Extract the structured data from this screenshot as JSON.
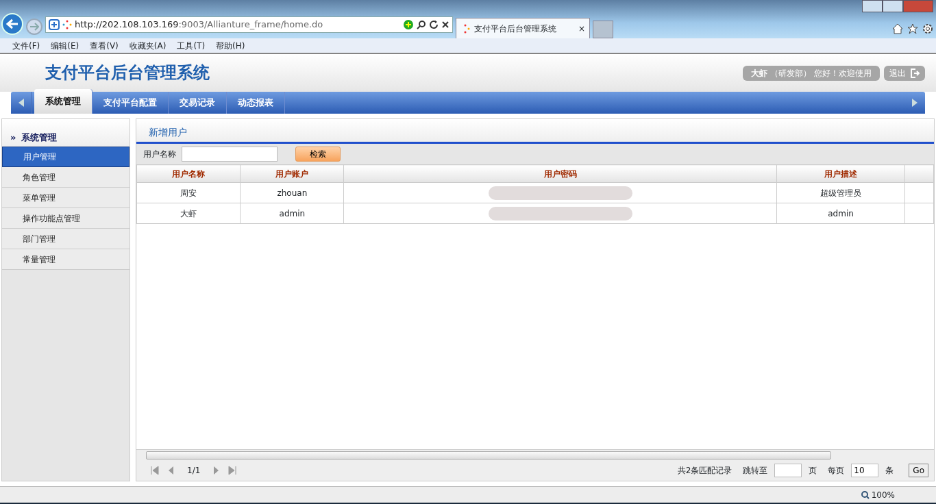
{
  "browser": {
    "url_host": "http://202.108.103.169",
    "url_rest": ":9003/Allianture_frame/home.do",
    "tab_title": "支付平台后台管理系统",
    "tab_close": "×",
    "menu": [
      "文件(F)",
      "编辑(E)",
      "查看(V)",
      "收藏夹(A)",
      "工具(T)",
      "帮助(H)"
    ]
  },
  "app": {
    "title": "支付平台后台管理系统",
    "user": {
      "name": "大虾",
      "dept": "（研发部）",
      "greeting": "您好！欢迎使用"
    },
    "logout": "退出",
    "tabs": [
      {
        "label": "系统管理",
        "selected": true
      },
      {
        "label": "支付平台配置",
        "selected": false
      },
      {
        "label": "交易记录",
        "selected": false
      },
      {
        "label": "动态报表",
        "selected": false
      }
    ]
  },
  "sidebar": {
    "heading": "系统管理",
    "marker": "»",
    "items": [
      {
        "label": "用户管理",
        "selected": true
      },
      {
        "label": "角色管理",
        "selected": false
      },
      {
        "label": "菜单管理",
        "selected": false
      },
      {
        "label": "操作功能点管理",
        "selected": false
      },
      {
        "label": "部门管理",
        "selected": false
      },
      {
        "label": "常量管理",
        "selected": false
      }
    ]
  },
  "panel": {
    "tab": "新增用户",
    "search_label": "用户名称",
    "search_button": "检索",
    "table": {
      "columns": [
        "用户名称",
        "用户账户",
        "用户密码",
        "用户描述"
      ],
      "rows": [
        {
          "cells": [
            "周安",
            "zhouan",
            "",
            "超级管理员"
          ],
          "redacted": true
        },
        {
          "cells": [
            "大虾",
            "admin",
            "",
            "admin"
          ],
          "redacted": true
        }
      ]
    },
    "pager": {
      "page": "1/1",
      "total": "共2条匹配记录",
      "jump_label": "跳转至",
      "page_unit": "页",
      "per_page_label": "每页",
      "per_page": "10",
      "per_page_unit": "条",
      "go": "Go"
    }
  },
  "status_bar": {
    "zoom": "100%"
  }
}
